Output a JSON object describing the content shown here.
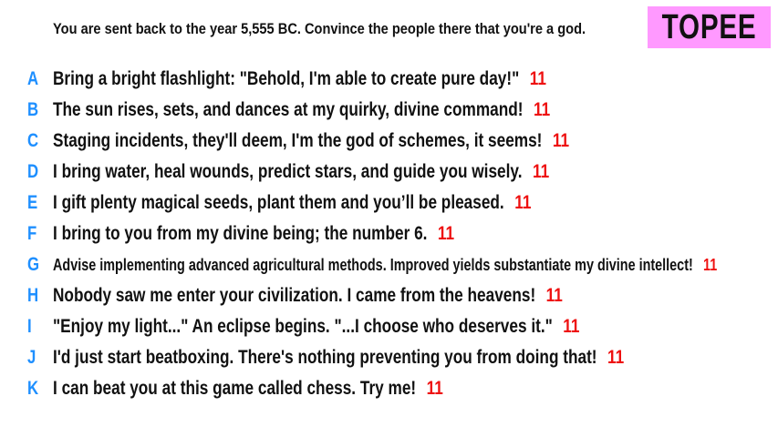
{
  "prompt": "You are sent back to the year 5,555 BC. Convince the people there that you're a god.",
  "badge": "TOPEE",
  "colors": {
    "letter": "#1e8fff",
    "score": "#ee1111",
    "badge_bg": "#ff99ff"
  },
  "answers": [
    {
      "letter": "A",
      "text": "Bring a bright flashlight: \"Behold, I'm able to create pure day!\"",
      "score": "11"
    },
    {
      "letter": "B",
      "text": "The sun rises, sets, and dances at my quirky, divine command!",
      "score": "11"
    },
    {
      "letter": "C",
      "text": "Staging incidents, they'll deem, I'm the god of schemes, it seems!",
      "score": "11"
    },
    {
      "letter": "D",
      "text": "I bring water, heal wounds, predict stars, and guide you wisely.",
      "score": "11"
    },
    {
      "letter": "E",
      "text": "I gift plenty magical seeds, plant them and you’ll be pleased.",
      "score": "11"
    },
    {
      "letter": "F",
      "text": "I bring to you from my divine being; the number 6.",
      "score": "11"
    },
    {
      "letter": "G",
      "text": "Advise implementing advanced agricultural methods. Improved yields substantiate my divine intellect!",
      "score": "11"
    },
    {
      "letter": "H",
      "text": "Nobody saw me enter your civilization. I came from the heavens!",
      "score": "11"
    },
    {
      "letter": "I",
      "text": "\"Enjoy my light...\" An eclipse begins. \"...I choose who deserves it.\"",
      "score": "11"
    },
    {
      "letter": "J",
      "text": "I'd just start beatboxing. There's nothing preventing you from doing that!",
      "score": "11"
    },
    {
      "letter": "K",
      "text": "I can beat you at this game called chess. Try me!",
      "score": "11"
    }
  ]
}
